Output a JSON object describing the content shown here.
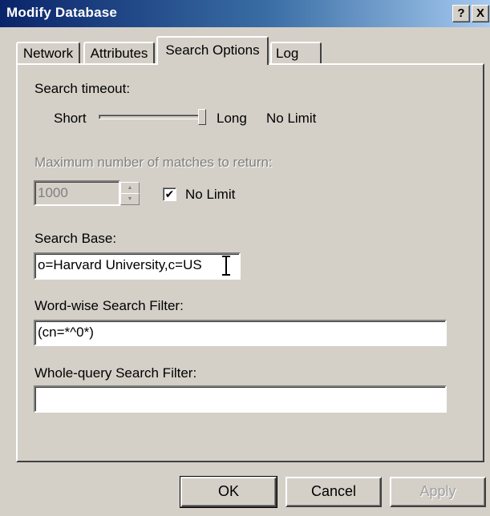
{
  "window": {
    "title": "Modify Database",
    "help_label": "?",
    "close_label": "X"
  },
  "tabs": [
    {
      "label": "Network",
      "active": false
    },
    {
      "label": "Attributes",
      "active": false
    },
    {
      "label": "Search Options",
      "active": true
    },
    {
      "label": "Log",
      "active": false
    }
  ],
  "search_timeout": {
    "label": "Search timeout:",
    "short_label": "Short",
    "long_label": "Long",
    "value_label": "No Limit",
    "slider_level": 1.0
  },
  "max_matches": {
    "label": "Maximum number of matches to return:",
    "value": "1000",
    "no_limit_label": "No Limit",
    "no_limit_checked": true,
    "check_glyph": "✔"
  },
  "search_base": {
    "label": "Search Base:",
    "value": "o=Harvard University,c=US"
  },
  "word_filter": {
    "label": "Word-wise Search Filter:",
    "value": "(cn=*^0*)"
  },
  "query_filter": {
    "label": "Whole-query Search Filter:",
    "value": ""
  },
  "buttons": {
    "ok": "OK",
    "cancel": "Cancel",
    "apply": "Apply"
  },
  "colors": {
    "title_gradient_start": "#0a246a",
    "title_gradient_end": "#a6caf0",
    "face": "#d4d0c8"
  }
}
